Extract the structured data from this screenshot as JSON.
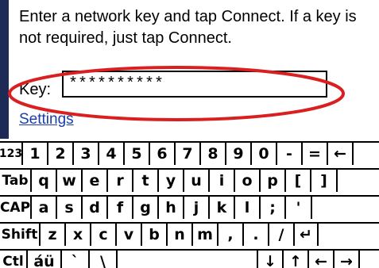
{
  "dialog": {
    "prompt": "Enter a network key and tap Connect. If a key is not required, just tap Connect.",
    "key_label": "Key:",
    "key_value": "**********",
    "settings_link": "Settings"
  },
  "colors": {
    "annotation_circle": "#d91f1f",
    "link": "#1a3fa8",
    "left_strip": "#1d2a55"
  },
  "keyboard": {
    "rows": [
      [
        "123",
        "1",
        "2",
        "3",
        "4",
        "5",
        "6",
        "7",
        "8",
        "9",
        "0",
        "-",
        "=",
        "←"
      ],
      [
        "Tab",
        "q",
        "w",
        "e",
        "r",
        "t",
        "y",
        "u",
        "i",
        "o",
        "p",
        "[",
        "]"
      ],
      [
        "CAP",
        "a",
        "s",
        "d",
        "f",
        "g",
        "h",
        "j",
        "k",
        "l",
        ";",
        "'"
      ],
      [
        "Shift",
        "z",
        "x",
        "c",
        "v",
        "b",
        "n",
        "m",
        ",",
        ".",
        "/",
        "↵"
      ],
      [
        "Ctl",
        "áü",
        "`",
        "\\",
        "",
        "↓",
        "↑",
        "←",
        "→"
      ]
    ]
  }
}
